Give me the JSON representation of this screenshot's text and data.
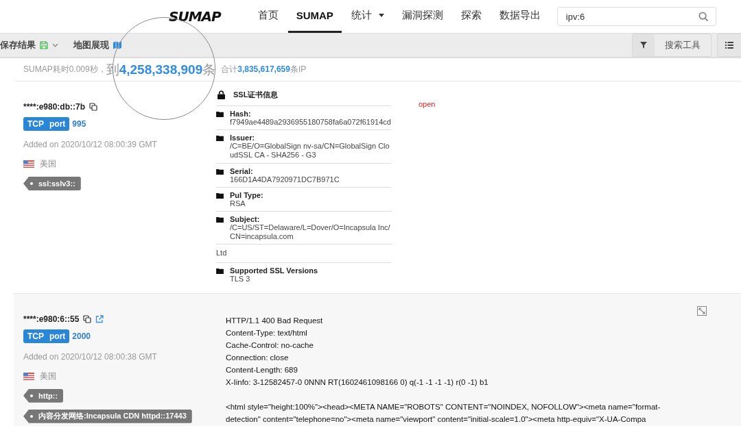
{
  "nav": {
    "logo": "SUMAP",
    "items": [
      {
        "label": "首页",
        "selected": false,
        "caret": false
      },
      {
        "label": "SUMAP",
        "selected": true,
        "caret": false
      },
      {
        "label": "统计",
        "selected": false,
        "caret": true
      },
      {
        "label": "漏洞探测",
        "selected": false,
        "caret": false
      },
      {
        "label": "探索",
        "selected": false,
        "caret": false
      },
      {
        "label": "数据导出",
        "selected": false,
        "caret": false
      }
    ],
    "search": {
      "value": "ipv:6"
    }
  },
  "toolbar": {
    "save": "保存结果",
    "map": "地图展现",
    "search_tools": "搜索工具"
  },
  "stats": {
    "prefix": "SUMAP耗时0.009秒，",
    "count_prefix": "到",
    "count": "4,258,338,909",
    "count_suffix": "条",
    "total_prefix": "合计",
    "total": "3,835,617,659",
    "total_suffix": "条IP"
  },
  "records": [
    {
      "kind": "ssl",
      "address": "****:e980:db::7b",
      "external_link": false,
      "protocol": "TCP",
      "port_label": "port",
      "port": "995",
      "added": "Added on 2020/10/12 08:00:39 GMT",
      "country": "美国",
      "tags": [
        "ssl:sslv3::"
      ],
      "status": "open",
      "ssl": {
        "title": "SSL证书信息",
        "fields": [
          {
            "kind": "field",
            "label": "Hash:",
            "value": "f7949ae4489a2936955180758fa6a072f61914cd"
          },
          {
            "kind": "field",
            "label": "Issuer:",
            "value": "/C=BE/O=GlobalSign nv-sa/CN=GlobalSign CloudSSL CA - SHA256 - G3"
          },
          {
            "kind": "field",
            "label": "Serial:",
            "value": "166D1A4DA7920971DC7B971C"
          },
          {
            "kind": "field",
            "label": "Pul Type:",
            "value": "RSA"
          },
          {
            "kind": "field",
            "label": "Subject:",
            "value": "/C=US/ST=Delaware/L=Dover/O=Incapsula Inc/CN=incapsula.com"
          },
          {
            "kind": "plain",
            "value": "Ltd"
          },
          {
            "kind": "field",
            "label": "Supported SSL Versions",
            "value": "TLS 3"
          }
        ]
      }
    },
    {
      "kind": "http",
      "address": "****:e980:6::55",
      "external_link": true,
      "protocol": "TCP",
      "port_label": "port",
      "port": "2000",
      "added": "Added on 2020/10/12 08:00:38 GMT",
      "country": "美国",
      "tags": [
        "http::",
        "内容分发网络:Incapsula CDN httpd::17443"
      ],
      "banner": {
        "lines": [
          "HTTP/1.1 400 Bad Request",
          "Content-Type: text/html",
          "Cache-Control: no-cache",
          "Connection: close",
          "Content-Length: 689",
          "X-Iinfo: 3-12582457-0 0NNN RT(1602461098166 0) q(-1 -1 -1 -1) r(0 -1) b1"
        ],
        "body": "<html style=\"height:100%\"><head><META NAME=\"ROBOTS\" CONTENT=\"NOINDEX, NOFOLLOW\"><meta name=\"format-detection\" content=\"telephone=no\"><meta name=\"viewport\" content=\"initial-scale=1.0\"><meta http-equiv=\"X-UA-Compa"
      }
    }
  ]
}
